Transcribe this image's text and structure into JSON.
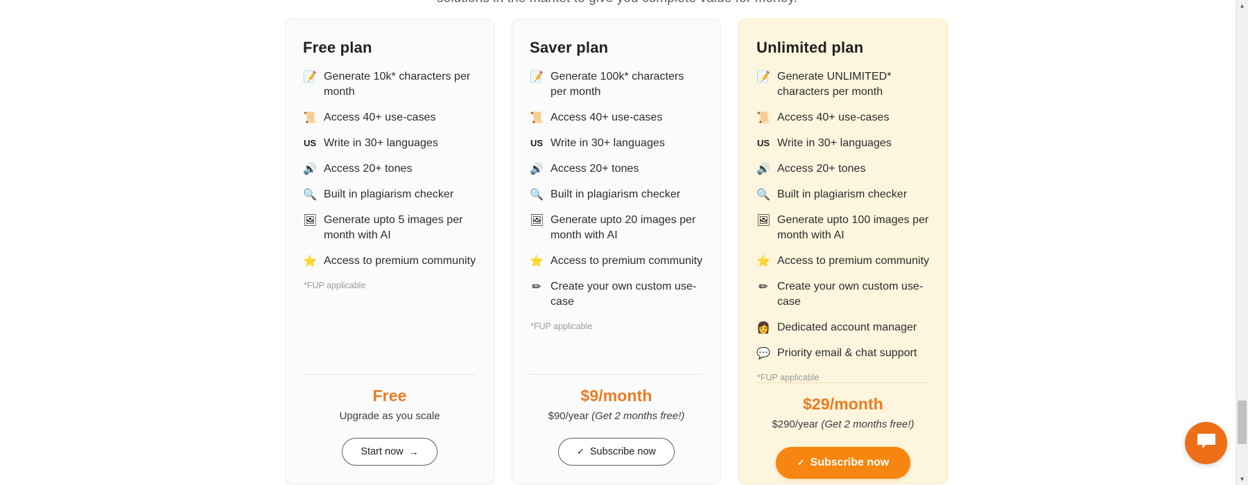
{
  "page": {
    "intro_cutoff": "solutions in the market to give you complete value for money."
  },
  "plans": [
    {
      "id": "free",
      "title": "Free plan",
      "featured": false,
      "features": [
        {
          "icon": "memo-icon",
          "glyph": "📝",
          "text": "Generate 10k* characters per month"
        },
        {
          "icon": "scroll-icon",
          "glyph": "📜",
          "text": "Access 40+ use-cases"
        },
        {
          "icon": "us-flag-icon",
          "glyph": "US",
          "text": "Write in 30+ languages"
        },
        {
          "icon": "speaker-icon",
          "glyph": "🔊",
          "text": "Access 20+ tones"
        },
        {
          "icon": "magnifier-icon",
          "glyph": "🔍",
          "text": "Built in plagiarism checker"
        },
        {
          "icon": "framed-picture-icon",
          "glyph": "🖼",
          "text": "Generate upto 5 images per month with AI"
        },
        {
          "icon": "star-icon",
          "glyph": "⭐",
          "text": "Access to premium community"
        }
      ],
      "fup_note": "*FUP applicable",
      "price": "Free",
      "price_sub_plain": "Upgrade as you scale",
      "price_sub_italic": "",
      "cta_label": "Start now",
      "cta_icon": "arrow-right-icon",
      "cta_glyph": "→",
      "cta_style": "outline"
    },
    {
      "id": "saver",
      "title": "Saver plan",
      "featured": false,
      "features": [
        {
          "icon": "memo-icon",
          "glyph": "📝",
          "text": "Generate 100k* characters per month"
        },
        {
          "icon": "scroll-icon",
          "glyph": "📜",
          "text": "Access 40+ use-cases"
        },
        {
          "icon": "us-flag-icon",
          "glyph": "US",
          "text": "Write in 30+ languages"
        },
        {
          "icon": "speaker-icon",
          "glyph": "🔊",
          "text": "Access 20+ tones"
        },
        {
          "icon": "magnifier-icon",
          "glyph": "🔍",
          "text": "Built in plagiarism checker"
        },
        {
          "icon": "framed-picture-icon",
          "glyph": "🖼",
          "text": "Generate upto 20 images per month with AI"
        },
        {
          "icon": "star-icon",
          "glyph": "⭐",
          "text": "Access to premium community"
        },
        {
          "icon": "pencil-icon",
          "glyph": "✏",
          "text": "Create your own custom use-case"
        }
      ],
      "fup_note": "*FUP applicable",
      "price": "$9/month",
      "price_sub_plain": "$90/year ",
      "price_sub_italic": "(Get 2 months free!)",
      "cta_label": "Subscribe now",
      "cta_icon": "check-icon",
      "cta_glyph": "✓",
      "cta_style": "outline"
    },
    {
      "id": "unlimited",
      "title": "Unlimited plan",
      "featured": true,
      "features": [
        {
          "icon": "memo-icon",
          "glyph": "📝",
          "text": "Generate UNLIMITED* characters per month"
        },
        {
          "icon": "scroll-icon",
          "glyph": "📜",
          "text": "Access 40+ use-cases"
        },
        {
          "icon": "us-flag-icon",
          "glyph": "US",
          "text": "Write in 30+ languages"
        },
        {
          "icon": "speaker-icon",
          "glyph": "🔊",
          "text": "Access 20+ tones"
        },
        {
          "icon": "magnifier-icon",
          "glyph": "🔍",
          "text": "Built in plagiarism checker"
        },
        {
          "icon": "framed-picture-icon",
          "glyph": "🖼",
          "text": "Generate upto 100 images per month with AI"
        },
        {
          "icon": "star-icon",
          "glyph": "⭐",
          "text": "Access to premium community"
        },
        {
          "icon": "pencil-icon",
          "glyph": "✏",
          "text": "Create your own custom use-case"
        },
        {
          "icon": "person-icon",
          "glyph": "👩",
          "text": "Dedicated account manager"
        },
        {
          "icon": "speech-balloon-icon",
          "glyph": "💬",
          "text": "Priority email & chat support"
        }
      ],
      "fup_note": "*FUP applicable",
      "price": "$29/month",
      "price_sub_plain": "$290/year ",
      "price_sub_italic": "(Get 2 months free!)",
      "cta_label": "Subscribe now",
      "cta_icon": "check-icon",
      "cta_glyph": "✓",
      "cta_style": "solid"
    }
  ],
  "chat_widget": {
    "icon": "chat-bubble-icon"
  },
  "scrollbar": {
    "up_arrow": "▲",
    "down_arrow": "▼"
  },
  "colors": {
    "accent_orange": "#ed7a21",
    "cta_orange": "#f5860f",
    "featured_bg": "#fdf5dd",
    "card_bg": "#fbfbfb"
  }
}
